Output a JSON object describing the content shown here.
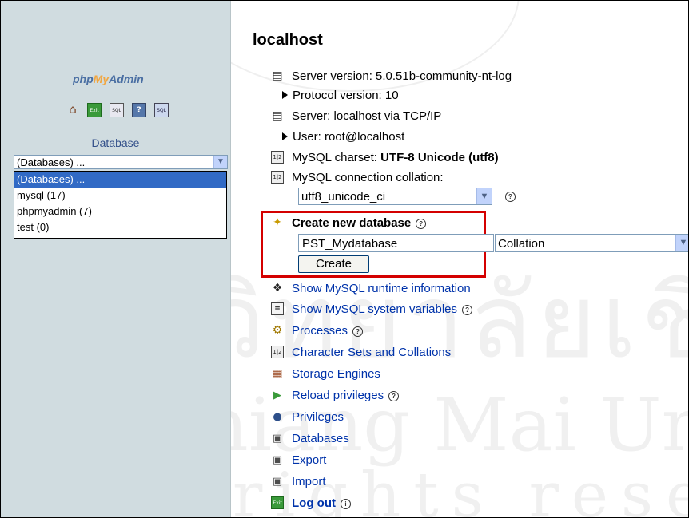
{
  "left": {
    "logo_php": "php",
    "logo_my": "My",
    "logo_admin": "Admin",
    "toolbar_icons": [
      "home-icon",
      "exit-icon",
      "sql-query-icon",
      "help-icon",
      "sql-docs-icon"
    ],
    "database_label": "Database",
    "database_select_value": "(Databases) ...",
    "database_options": [
      "(Databases) ...",
      "mysql (17)",
      "phpmyadmin (7)",
      "test (0)"
    ]
  },
  "main": {
    "title": "localhost",
    "server_version": "Server version: 5.0.51b-community-nt-log",
    "protocol_version": "Protocol version: 10",
    "server": "Server: localhost via TCP/IP",
    "user": "User: root@localhost",
    "charset_label": "MySQL charset: ",
    "charset_value": "UTF-8 Unicode (utf8)",
    "connection_collation_label": "MySQL connection collation:",
    "connection_collation_value": "utf8_unicode_ci",
    "create_db_label": "Create new database",
    "create_db_input_value": "PST_Mydatabase",
    "collation_select_value": "Collation",
    "create_button_label": "Create",
    "links": [
      "Show MySQL runtime information",
      "Show MySQL system variables",
      "Processes",
      "Character Sets and Collations",
      "Storage Engines",
      "Reload privileges",
      "Privileges",
      "Databases",
      "Export",
      "Import"
    ],
    "logout_label": "Log out"
  },
  "watermark": {
    "line1": "มหาวิทยาลัยเชียงใหม่",
    "line2": "by Chiang Mai University",
    "line3": "All rights reserved"
  },
  "colors": {
    "left_panel_bg": "#d0dce0",
    "link": "#0033aa",
    "highlight_box": "#d40000",
    "selected_option": "#316ac5"
  }
}
